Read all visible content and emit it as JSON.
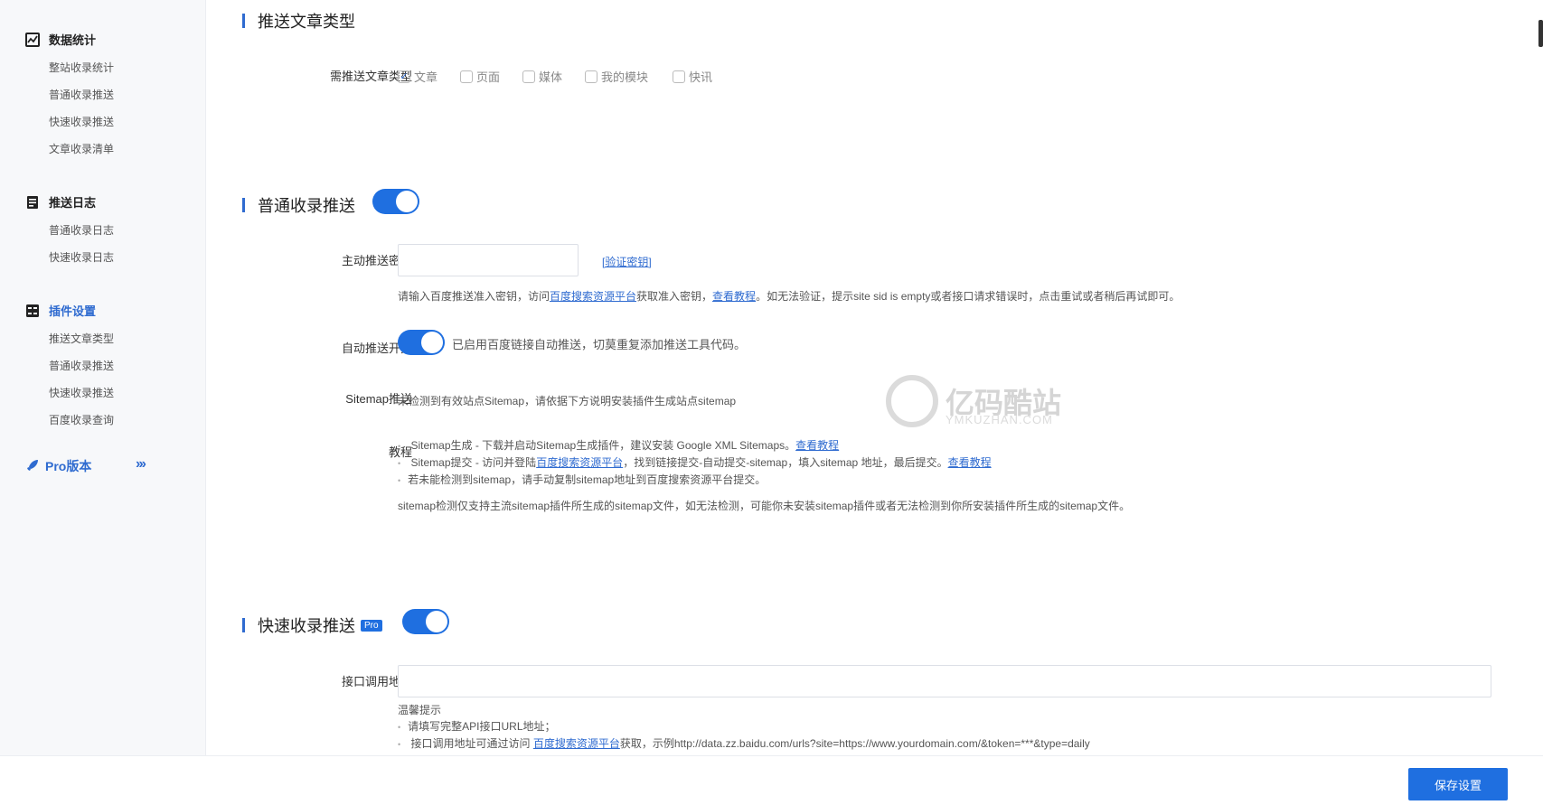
{
  "sidebar": {
    "sections": [
      {
        "title": "数据统计",
        "items": [
          "整站收录统计",
          "普通收录推送",
          "快速收录推送",
          "文章收录清单"
        ]
      },
      {
        "title": "推送日志",
        "items": [
          "普通收录日志",
          "快速收录日志"
        ]
      },
      {
        "title": "插件设置",
        "items": [
          "推送文章类型",
          "普通收录推送",
          "快速收录推送",
          "百度收录查询"
        ]
      }
    ],
    "pro_label": "Pro版本",
    "pro_arrows": "›››"
  },
  "post_types": {
    "title": "推送文章类型",
    "label": "需推送文章类型",
    "options": [
      {
        "label": "文章",
        "checked": true
      },
      {
        "label": "页面",
        "checked": false
      },
      {
        "label": "媒体",
        "checked": false
      },
      {
        "label": "我的模块",
        "checked": false
      },
      {
        "label": "快讯",
        "checked": false
      }
    ]
  },
  "normal_push": {
    "title": "普通收录推送",
    "enabled": true,
    "key_label": "主动推送密钥",
    "key_value": "",
    "verify_link": "[验证密钥]",
    "key_help_1": "请输入百度推送准入密钥，访问",
    "key_help_link": "百度搜索资源平台",
    "key_help_2": "获取准入密钥，",
    "key_help_tutorial": "查看教程",
    "key_help_3": "。如无法验证，提示site sid is empty或者接口请求错误时，点击重试或者稍后再试即可。",
    "auto_label": "自动推送开关",
    "auto_enabled": true,
    "auto_text": "已启用百度链接自动推送，切莫重复添加推送工具代码。",
    "sitemap_label": "Sitemap推送",
    "sitemap_text": "未检测到有效站点Sitemap，请依据下方说明安装插件生成站点sitemap",
    "tutorial_label": "教程",
    "tutorial_1a": "Sitemap生成 - 下载并启动Sitemap生成插件，建议安装 Google XML Sitemaps。",
    "tutorial_1_link": "查看教程",
    "tutorial_2a": "Sitemap提交 - 访问并登陆",
    "tutorial_2_link1": "百度搜索资源平台",
    "tutorial_2b": "，找到链接提交-自动提交-sitemap，填入sitemap 地址，最后提交。",
    "tutorial_2_link2": "查看教程",
    "tutorial_3": "若未能检测到sitemap，请手动复制sitemap地址到百度搜索资源平台提交。",
    "tutorial_note": "sitemap检测仅支持主流sitemap插件所生成的sitemap文件，如无法检测，可能你未安装sitemap插件或者无法检测到你所安装插件所生成的sitemap文件。"
  },
  "fast_push": {
    "title": "快速收录推送",
    "badge": "Pro",
    "enabled": true,
    "api_label": "接口调用地址",
    "api_value": "",
    "tips_title": "温馨提示",
    "tip_1": "请填写完整API接口URL地址；",
    "tip_2a": "接口调用地址可通过访问 ",
    "tip_2_link": "百度搜索资源平台",
    "tip_2b": "获取，示例http://data.zz.baidu.com/urls?site=https://www.yourdomain.com/&token=***&type=daily"
  },
  "watermark": {
    "text": "亿码酷站",
    "sub": "YMKUZHAN.COM"
  },
  "footer": {
    "save_label": "保存设置"
  },
  "colors": {
    "accent": "#1f6fe0",
    "link": "#2f6bd0",
    "sidebar_bg": "#f7f8fa"
  }
}
